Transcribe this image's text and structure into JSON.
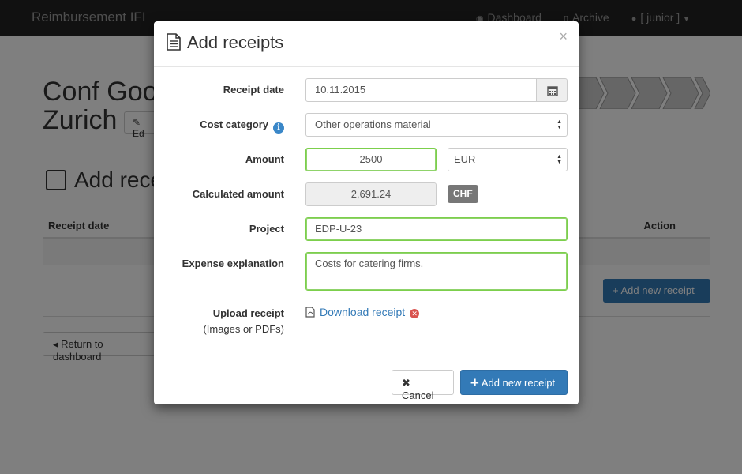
{
  "navbar": {
    "brand": "Reimbursement IFI",
    "links": [
      {
        "label": "Dashboard",
        "icon": "dashboard-icon"
      },
      {
        "label": "Archive",
        "icon": "document-icon"
      },
      {
        "label": "[ junior ]",
        "icon": "user-icon"
      }
    ]
  },
  "background": {
    "title_line1": "Conf Goo",
    "title_line2": "Zurich",
    "edit_label": "Ed",
    "section_title": "Add rece",
    "table_headers": [
      "Receipt date",
      "Action"
    ],
    "add_receipt_button": "+ Add new receipt",
    "return_button": "Return to dashboard"
  },
  "modal": {
    "title": "Add receipts",
    "close": "×",
    "receipt_date": {
      "label": "Receipt date",
      "value": "10.11.2015"
    },
    "cost_category": {
      "label": "Cost category",
      "value": "Other operations material"
    },
    "amount": {
      "label": "Amount",
      "value": "2500",
      "currency": "EUR"
    },
    "calculated_amount": {
      "label": "Calculated amount",
      "value": "2,691.24",
      "currency": "CHF"
    },
    "project": {
      "label": "Project",
      "value": "EDP-U-23"
    },
    "expense_explanation": {
      "label": "Expense explanation",
      "value": "Costs for catering firms."
    },
    "upload": {
      "label": "Upload receipt",
      "sublabel": "(Images or PDFs)",
      "link": "Download receipt"
    },
    "cancel_button": "Cancel",
    "add_button": "Add new receipt"
  },
  "colors": {
    "primary": "#337ab7",
    "success_border": "#7ccf4c",
    "danger": "#d9534f",
    "navbar": "#222222"
  }
}
